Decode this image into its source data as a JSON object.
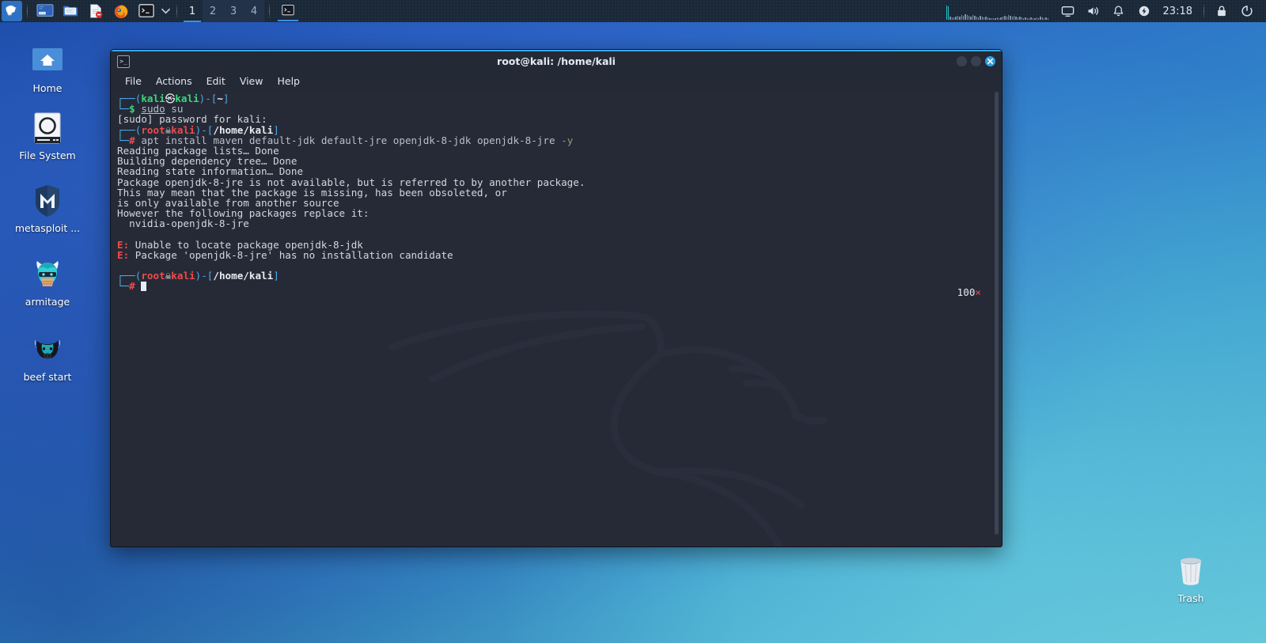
{
  "panel": {
    "menu_button": "kali-dragon-menu",
    "launchers": [
      {
        "name": "show-desktop-icon",
        "label": "Show Desktop"
      },
      {
        "name": "file-manager-icon",
        "label": "File Manager"
      },
      {
        "name": "text-editor-icon",
        "label": "Text Editor"
      },
      {
        "name": "firefox-icon",
        "label": "Firefox ESR"
      },
      {
        "name": "terminal-icon",
        "label": "Terminal"
      }
    ],
    "dropdown_label": "More Applications",
    "workspaces": [
      {
        "label": "1",
        "active": true
      },
      {
        "label": "2",
        "active": false
      },
      {
        "label": "3",
        "active": false
      },
      {
        "label": "4",
        "active": false
      }
    ],
    "task_buttons": [
      {
        "name": "taskbar-terminal",
        "label": "root@kali: /home/kali"
      }
    ],
    "tray": [
      {
        "name": "cpu-graph-monitor",
        "label": "CPU Graph"
      },
      {
        "name": "display-icon",
        "label": "Display"
      },
      {
        "name": "volume-icon",
        "label": "Volume"
      },
      {
        "name": "notification-bell-icon",
        "label": "Notifications"
      },
      {
        "name": "power-manager-icon",
        "label": "Power Manager"
      }
    ],
    "clock": "23:18",
    "lock_icon": "lock-screen",
    "logout_icon": "log-out"
  },
  "desktop_icons": [
    {
      "name": "home",
      "label": "Home",
      "icon": "home-folder-icon"
    },
    {
      "name": "file-system",
      "label": "File System",
      "icon": "harddisk-icon"
    },
    {
      "name": "metasploit",
      "label": "metasploit ...",
      "icon": "metasploit-icon"
    },
    {
      "name": "armitage",
      "label": "armitage",
      "icon": "armitage-icon"
    },
    {
      "name": "beef-start",
      "label": "beef start",
      "icon": "beef-bull-icon"
    },
    {
      "name": "trash",
      "label": "Trash",
      "icon": "trash-can-icon"
    }
  ],
  "terminal": {
    "title": "root@kali: /home/kali",
    "icon": "terminal-window-icon",
    "menus": [
      "File",
      "Actions",
      "Edit",
      "View",
      "Help"
    ],
    "window_buttons": {
      "minimize": "minimize-button",
      "maximize": "maximize-button",
      "close": "close-button"
    },
    "exit_status": {
      "code": "100",
      "marker": "×"
    },
    "prompts": {
      "user_host_1": "kali㉿kali",
      "path_1": "~",
      "sigil_1": "$",
      "user_host_2": "root☠kali",
      "path_2": "/home/kali",
      "sigil_2": "#"
    },
    "lines": [
      {
        "type": "prompt1"
      },
      {
        "type": "cmdline1",
        "cmd": "sudo",
        "args": " su"
      },
      {
        "type": "plain",
        "text": "[sudo] password for kali:"
      },
      {
        "type": "prompt2"
      },
      {
        "type": "cmdline2",
        "cmd": "apt",
        "args": " install maven default-jdk default-jre openjdk-8-jdk openjdk-8-jre ",
        "flag": "-y"
      },
      {
        "type": "plain",
        "text": "Reading package lists… Done"
      },
      {
        "type": "plain",
        "text": "Building dependency tree… Done"
      },
      {
        "type": "plain",
        "text": "Reading state information… Done"
      },
      {
        "type": "plain",
        "text": "Package openjdk-8-jre is not available, but is referred to by another package."
      },
      {
        "type": "plain",
        "text": "This may mean that the package is missing, has been obsoleted, or"
      },
      {
        "type": "plain",
        "text": "is only available from another source"
      },
      {
        "type": "plain",
        "text": "However the following packages replace it:"
      },
      {
        "type": "plain",
        "text": "  nvidia-openjdk-8-jre"
      },
      {
        "type": "blank",
        "text": " "
      },
      {
        "type": "error",
        "prefix": "E:",
        "text": " Unable to locate package openjdk-8-jdk"
      },
      {
        "type": "error",
        "prefix": "E:",
        "text": " Package 'openjdk-8-jre' has no installation candidate"
      },
      {
        "type": "blank",
        "text": " "
      },
      {
        "type": "prompt2"
      },
      {
        "type": "cursorline"
      }
    ]
  },
  "colors": {
    "accent": "#3ba7e0",
    "panel_bg": "#1b2838",
    "terminal_bg": "#252a36",
    "prompt_blue": "#4ea7e8",
    "prompt_green": "#3ad97b",
    "prompt_red": "#ef4b4b",
    "text": "#d3d7de"
  }
}
